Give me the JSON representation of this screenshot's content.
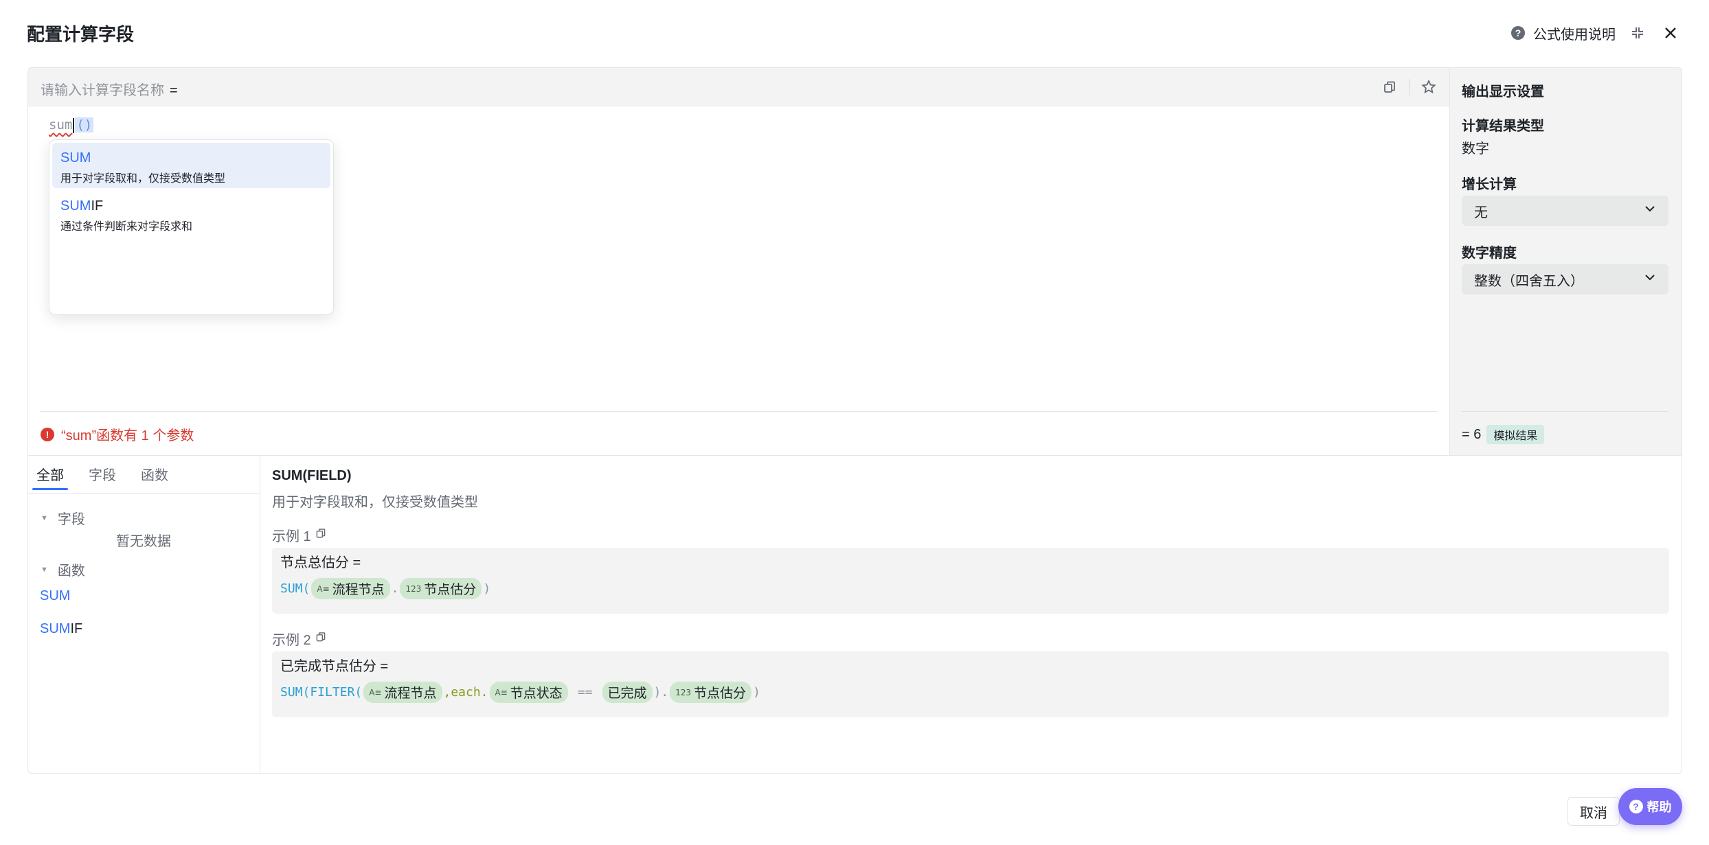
{
  "dialog": {
    "title": "配置计算字段",
    "help_link": "公式使用说明"
  },
  "editor": {
    "name_placeholder": "请输入计算字段名称",
    "equals": "=",
    "code_fn": "sum",
    "code_parens": "()",
    "error_text": "“sum”函数有 1 个参数"
  },
  "suggestions": [
    {
      "match": "SUM",
      "rest": "",
      "desc": "用于对字段取和，仅接受数值类型"
    },
    {
      "match": "SUM",
      "rest": "IF",
      "desc": "通过条件判断来对字段求和"
    }
  ],
  "output_settings": {
    "title": "输出显示设置",
    "result_type_label": "计算结果类型",
    "result_type_value": "数字",
    "growth_label": "增长计算",
    "growth_value": "无",
    "precision_label": "数字精度",
    "precision_value": "整数（四舍五入）",
    "result_prefix": "= 6",
    "result_badge": "模拟结果"
  },
  "library": {
    "tabs": [
      "全部",
      "字段",
      "函数"
    ],
    "group_fields": "字段",
    "empty": "暂无数据",
    "group_functions": "函数",
    "functions": [
      {
        "match": "SUM",
        "rest": ""
      },
      {
        "match": "SUM",
        "rest": "IF"
      }
    ]
  },
  "doc": {
    "title": "SUM(FIELD)",
    "desc": "用于对字段取和，仅接受数值类型",
    "example1_label": "示例 1",
    "example1_head": "节点总估分 =",
    "example1_fn": "SUM(",
    "example1_chip1": "流程节点",
    "example1_dot": ".",
    "example1_chip2": "节点估分",
    "example1_close": ")",
    "example2_label": "示例 2",
    "example2_head": "已完成节点估分 =",
    "example2_fn": "SUM(FILTER(",
    "example2_chip1": "流程节点",
    "example2_each": ",each.",
    "example2_chip2": "节点状态",
    "example2_op": "==",
    "example2_chip3": "已完成",
    "example2_close1": ").",
    "example2_chip4": "节点估分",
    "example2_close2": ")"
  },
  "footer": {
    "cancel": "取消",
    "help": "帮助"
  },
  "colors": {
    "accent": "#3370ff",
    "error": "#d83931",
    "chip": "#cfe6cf",
    "help_fab": "#7b6cf6"
  },
  "icons": {
    "text_field": "A≡",
    "number_field": "123"
  }
}
